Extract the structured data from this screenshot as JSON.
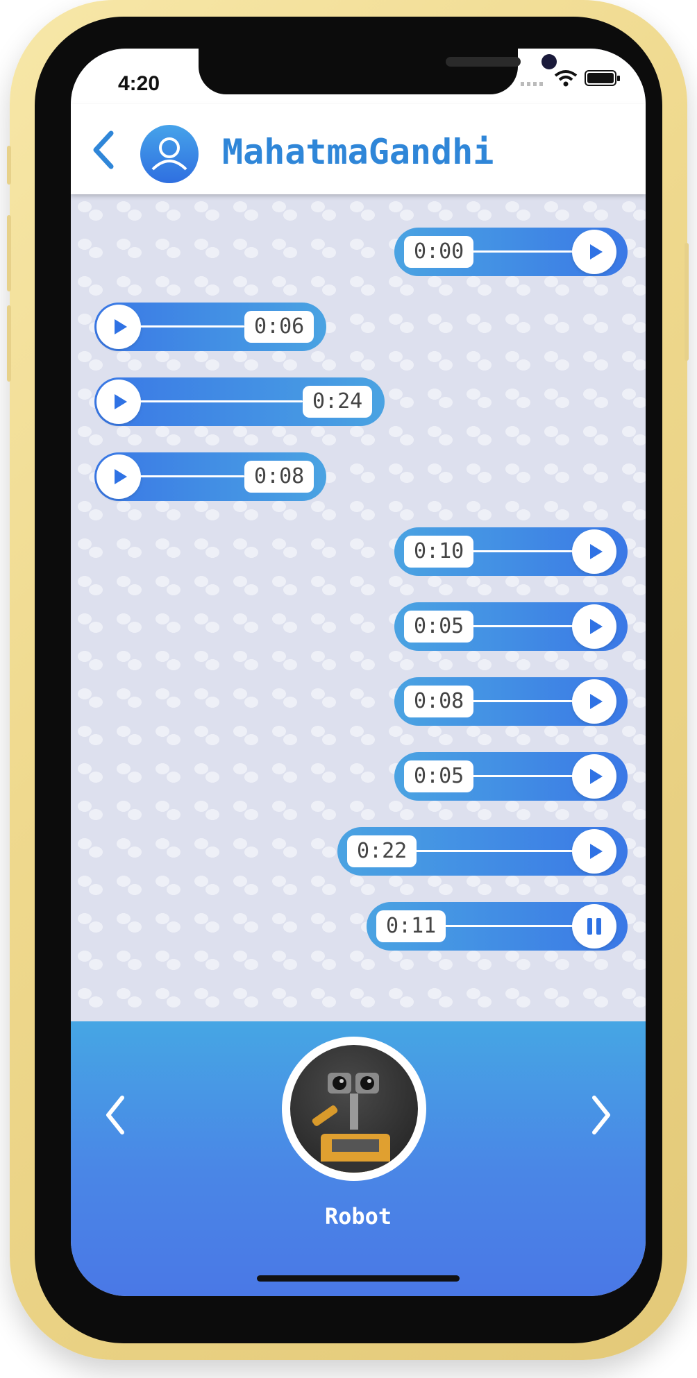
{
  "status_bar": {
    "time": "4:20"
  },
  "header": {
    "contact_name": "MahatmaGandhi"
  },
  "messages": [
    {
      "side": "right",
      "duration": "0:00",
      "state": "play"
    },
    {
      "side": "left",
      "duration": "0:06",
      "state": "play"
    },
    {
      "side": "left",
      "duration": "0:24",
      "state": "play"
    },
    {
      "side": "left",
      "duration": "0:08",
      "state": "play"
    },
    {
      "side": "right",
      "duration": "0:10",
      "state": "play"
    },
    {
      "side": "right",
      "duration": "0:05",
      "state": "play"
    },
    {
      "side": "right",
      "duration": "0:08",
      "state": "play"
    },
    {
      "side": "right",
      "duration": "0:05",
      "state": "play"
    },
    {
      "side": "right",
      "duration": "0:22",
      "state": "play"
    },
    {
      "side": "right",
      "duration": "0:11",
      "state": "pause"
    }
  ],
  "voice_selector": {
    "selected_voice": "Robot"
  },
  "icons": {
    "back": "chevron-left-icon",
    "avatar": "user-icon",
    "play": "play-icon",
    "pause": "pause-icon",
    "prev": "chevron-left-icon",
    "next": "chevron-right-icon"
  },
  "colors": {
    "accent": "#2f86d8",
    "bubble_start": "#4aa3e2",
    "bubble_end": "#3a78e6",
    "chat_background": "#dde0ee",
    "bottom_panel": "#4a86e6"
  }
}
